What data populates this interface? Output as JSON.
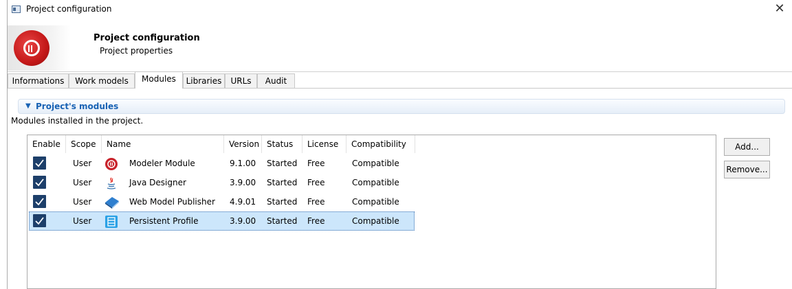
{
  "window": {
    "title": "Project configuration"
  },
  "header": {
    "title": "Project configuration",
    "subtitle": "Project properties"
  },
  "tabs": [
    {
      "label": "Informations"
    },
    {
      "label": "Work models"
    },
    {
      "label": "Modules",
      "active": true
    },
    {
      "label": "Libraries"
    },
    {
      "label": "URLs"
    },
    {
      "label": "Audit"
    }
  ],
  "section": {
    "title": "Project's modules",
    "description": "Modules installed in the project."
  },
  "table": {
    "columns": [
      "Enable",
      "Scope",
      "Name",
      "Version",
      "Status",
      "License",
      "Compatibility"
    ],
    "rows": [
      {
        "enabled": true,
        "scope": "User",
        "name": "Modeler Module",
        "icon": "modeler-icon",
        "version": "9.1.00",
        "status": "Started",
        "license": "Free",
        "compatibility": "Compatible"
      },
      {
        "enabled": true,
        "scope": "User",
        "name": "Java Designer",
        "icon": "java-icon",
        "version": "3.9.00",
        "status": "Started",
        "license": "Free",
        "compatibility": "Compatible"
      },
      {
        "enabled": true,
        "scope": "User",
        "name": "Web Model Publisher",
        "icon": "book-icon",
        "version": "4.9.01",
        "status": "Started",
        "license": "Free",
        "compatibility": "Compatible"
      },
      {
        "enabled": true,
        "scope": "User",
        "name": "Persistent Profile",
        "icon": "database-icon",
        "version": "3.9.00",
        "status": "Started",
        "license": "Free",
        "compatibility": "Compatible",
        "selected": true
      }
    ]
  },
  "buttons": {
    "add": "Add...",
    "remove": "Remove..."
  },
  "colors": {
    "accent": "#1862b4",
    "checkbox": "#1d3f6a",
    "selection": "#cce6fb"
  }
}
